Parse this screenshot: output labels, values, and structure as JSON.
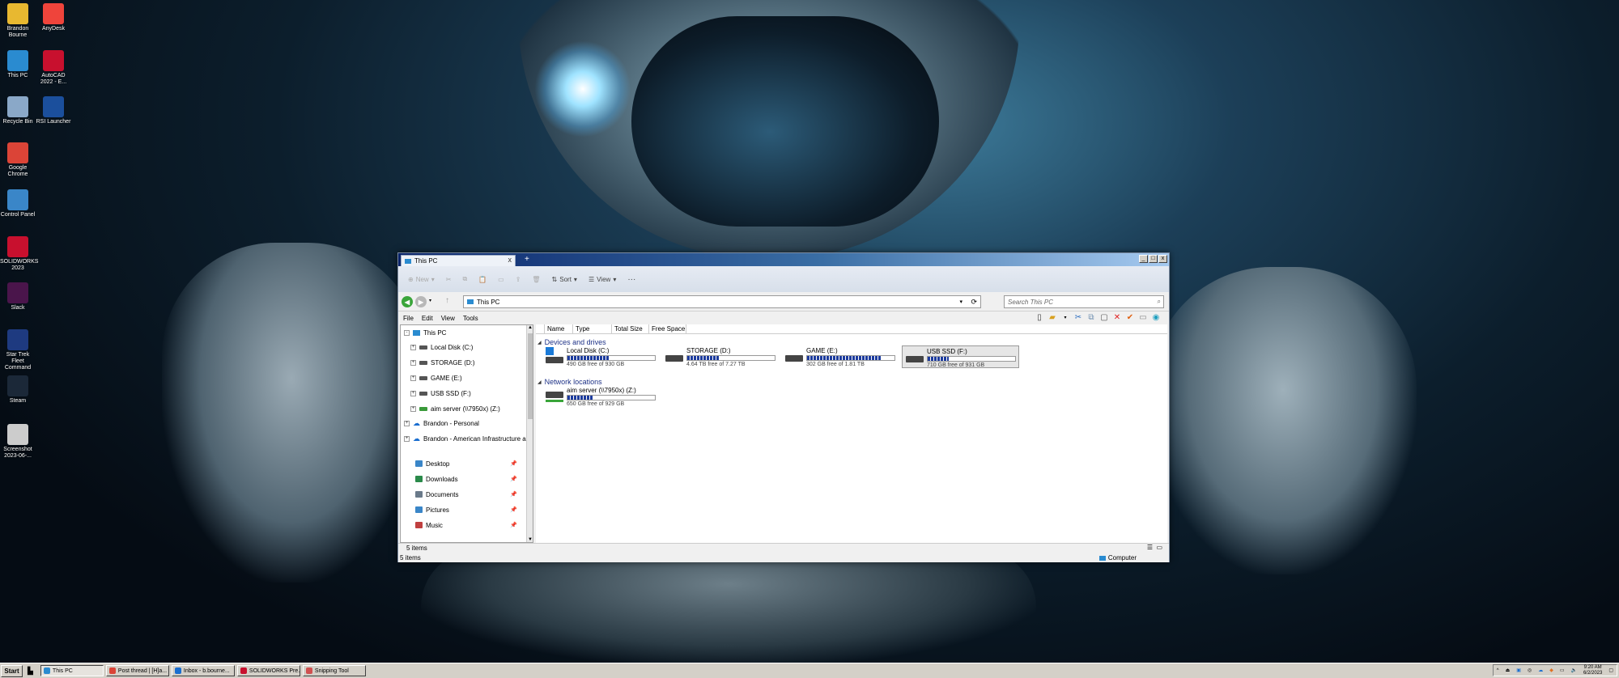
{
  "desktop_icons": [
    {
      "label": "Brandon Bourne",
      "icon": "folder-icon",
      "color": "#e8b830"
    },
    {
      "label": "AnyDesk",
      "icon": "anydesk-icon",
      "color": "#ef443b"
    },
    {
      "label": "This PC",
      "icon": "computer-icon",
      "color": "#2a8bd0"
    },
    {
      "label": "AutoCAD 2022 - E...",
      "icon": "autocad-icon",
      "color": "#c8102e"
    },
    {
      "label": "Recycle Bin",
      "icon": "recycle-bin-icon",
      "color": "#8aa8c8"
    },
    {
      "label": "RSI Launcher",
      "icon": "rsi-icon",
      "color": "#1b4f9c"
    },
    {
      "label": "Google Chrome",
      "icon": "chrome-icon",
      "color": "#db4437"
    },
    {
      "label": "Control Panel",
      "icon": "control-panel-icon",
      "color": "#3a86c8"
    },
    {
      "label": "SOLIDWORKS 2023",
      "icon": "solidworks-icon",
      "color": "#c8102e"
    },
    {
      "label": "Slack",
      "icon": "slack-icon",
      "color": "#4a154b"
    },
    {
      "label": "Star Trek Fleet Command",
      "icon": "star-trek-icon",
      "color": "#1e3a80"
    },
    {
      "label": "Steam",
      "icon": "steam-icon",
      "color": "#1b2838"
    },
    {
      "label": "Screenshot 2023-06-...",
      "icon": "screenshot-file-icon",
      "color": "#cccccc"
    }
  ],
  "window": {
    "tab_title": "This PC",
    "tab_add": "+",
    "minimize": "_",
    "maximize": "□",
    "close": "x"
  },
  "commandbar": {
    "new": "New",
    "sort": "Sort",
    "view": "View",
    "more": "···"
  },
  "address": {
    "path": "This PC",
    "search_placeholder": "Search This PC"
  },
  "menu": [
    "File",
    "Edit",
    "View",
    "Tools"
  ],
  "tree": {
    "root": "This PC",
    "drives": [
      "Local Disk (C:)",
      "STORAGE (D:)",
      "GAME (E:)",
      "USB SSD (F:)",
      "aim server (\\\\7950x) (Z:)"
    ],
    "clouds": [
      "Brandon - Personal",
      "Brandon - American Infrastructure and I"
    ],
    "quick": [
      "Desktop",
      "Downloads",
      "Documents",
      "Pictures",
      "Music"
    ]
  },
  "columns": [
    "Name",
    "Type",
    "Total Size",
    "Free Space"
  ],
  "groups": {
    "devices": "Devices and drives",
    "network": "Network locations"
  },
  "drives": [
    {
      "name": "Local Disk (C:)",
      "free": "490 GB free of 930 GB",
      "used_fraction": 0.47
    },
    {
      "name": "STORAGE (D:)",
      "free": "4.64 TB free of 7.27 TB",
      "used_fraction": 0.36
    },
    {
      "name": "GAME (E:)",
      "free": "302 GB free of 1.81 TB",
      "used_fraction": 0.84
    },
    {
      "name": "USB SSD (F:)",
      "free": "710 GB free of 931 GB",
      "used_fraction": 0.24
    }
  ],
  "network": [
    {
      "name": "aim server (\\\\7950x) (Z:)",
      "free": "650 GB free of 929 GB",
      "used_fraction": 0.3
    }
  ],
  "status": {
    "count_top": "5 items",
    "count_bottom": "5 items",
    "location": "Computer"
  },
  "taskbar": {
    "start": "Start",
    "buttons": [
      "This PC",
      "Post thread | [H]a...",
      "Inbox - b.bourne...",
      "SOLIDWORKS Pre...",
      "Snipping Tool"
    ],
    "time": "9:20 AM",
    "date": "6/2/2023"
  }
}
